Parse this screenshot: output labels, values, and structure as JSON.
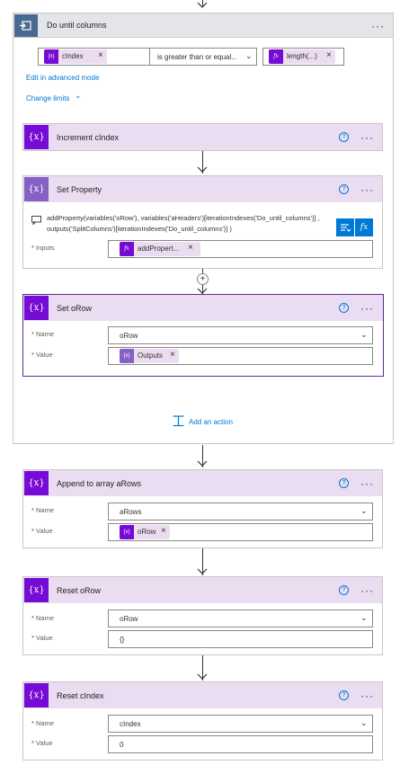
{
  "until": {
    "title": "Do until columns",
    "condition": {
      "left_token": "cIndex",
      "operator": "is greater than or equal...",
      "right_token": "length(...)"
    },
    "edit_advanced": "Edit in advanced mode",
    "change_limits": "Change limits"
  },
  "increment": {
    "title": "Increment cIndex"
  },
  "set_property": {
    "title": "Set Property",
    "expression_line1": "addProperty(variables('oRow'), variables('aHeaders')[iterationIndexes('Do_until_columns')] ,",
    "expression_line2": "outputs('SplitColumns')[iterationIndexes('Do_until_columns')] )",
    "inputs_label": "Inputs",
    "inputs_token": "addPropert...",
    "fx": "fx"
  },
  "set_orow": {
    "title": "Set oRow",
    "name_label": "Name",
    "name_value": "oRow",
    "value_label": "Value",
    "value_token": "Outputs"
  },
  "add_action": "Add an action",
  "append": {
    "title": "Append to array aRows",
    "name_label": "Name",
    "name_value": "aRows",
    "value_label": "Value",
    "value_token": "oRow"
  },
  "reset_orow": {
    "title": "Reset oRow",
    "name_label": "Name",
    "name_value": "oRow",
    "value_label": "Value",
    "value_text": "{}"
  },
  "reset_cindex": {
    "title": "Reset cIndex",
    "name_label": "Name",
    "name_value": "cIndex",
    "value_label": "Value",
    "value_text": "0"
  },
  "symbols": {
    "var_icon": "{x}",
    "more": "···",
    "help": "?",
    "remove": "×",
    "fx_token": "fx",
    "required": "*",
    "chevron": "⌄",
    "plus": "+"
  },
  "colors": {
    "variable_purple": "#770bd6",
    "header_lavender": "#eadcf1",
    "until_header": "#e3e5e8",
    "until_icon": "#486991",
    "link_blue": "#0078d4",
    "selected_border": "#5c2d91"
  }
}
